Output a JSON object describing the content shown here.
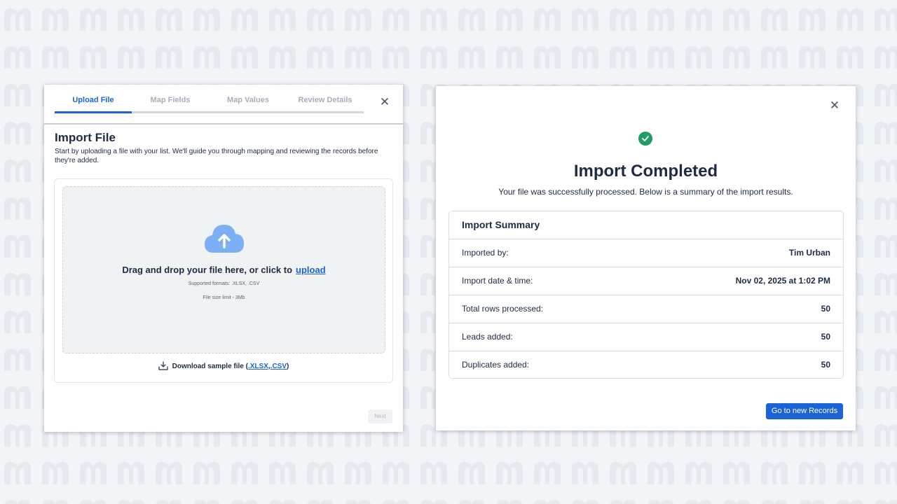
{
  "background": {
    "logo_glyph": "m"
  },
  "upload_modal": {
    "steps": [
      {
        "label": "Upload File",
        "active": true
      },
      {
        "label": "Map Fields",
        "active": false
      },
      {
        "label": "Map Values",
        "active": false
      },
      {
        "label": "Review Details",
        "active": false
      }
    ],
    "close_icon": "close-icon",
    "title": "Import File",
    "description": "Start by uploading a file with your list. We'll guide you through mapping and reviewing the records before they're added.",
    "drop_zone": {
      "icon": "cloud-upload-icon",
      "text": "Drag and drop your file here, or click to",
      "link": "upload",
      "formats": "Supported formats: .XLSX, .CSV",
      "limit": "File size limit - 3Mb"
    },
    "sample": {
      "icon": "download-icon",
      "prefix": "Download sample file (",
      "xlsx": ".XLSX",
      "comma": ",",
      "csv": ".CSV",
      "suffix": ")"
    },
    "next_label": "Next"
  },
  "complete_modal": {
    "close_icon": "close-icon",
    "status_icon": "check-circle-icon",
    "title": "Import Completed",
    "subtitle": "Your file was successfully processed. Below is a summary of the import results.",
    "summary": {
      "title": "Import Summary",
      "rows": [
        {
          "label": "Imported by:",
          "value": "Tim Urban"
        },
        {
          "label": "Import date & time:",
          "value": "Nov 02, 2025 at 1:02 PM"
        },
        {
          "label": "Total rows processed:",
          "value": "50"
        },
        {
          "label": "Leads added:",
          "value": "50"
        },
        {
          "label": "Duplicates added:",
          "value": "50"
        }
      ]
    },
    "button_label": "Go to new Records"
  },
  "colors": {
    "accent": "#1a64d8",
    "success": "#1f9d62",
    "text": "#1f2a44"
  }
}
